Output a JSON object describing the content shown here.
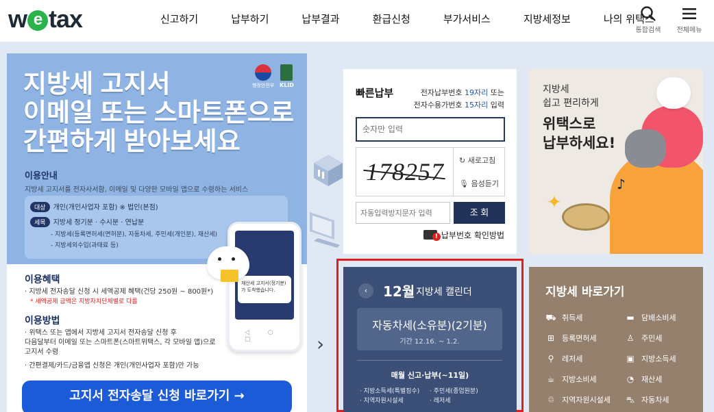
{
  "header": {
    "logo": {
      "prefix": "w",
      "e": "e",
      "suffix": "tax"
    },
    "nav": [
      "신고하기",
      "납부하기",
      "납부결과",
      "환급신청",
      "부가서비스",
      "지방세정보",
      "나의 위택스"
    ],
    "search_label": "통합검색",
    "menu_label": "전체메뉴"
  },
  "banner": {
    "title_lines": [
      "지방세 고지서",
      "이메일 또는 스마트폰으로",
      "간편하게 받아보세요"
    ],
    "gov_logo_text": "행정안전부",
    "klid_logo_text": "KLID",
    "guide_title": "이용안내",
    "guide_text": "지방세 고지서를 전자사서함, 이메일 및 다양한 모바일 앱으로 수령하는 서비스",
    "target_pill": "대상",
    "target_text": "개인(개인사업자 포함) ※ 법인(본점)",
    "tax_pill": "세목",
    "tax_text": "지방세 정기분 · 수시분 · 연납분",
    "tax_sub1": "- 지방세(등록면허세(면허분), 자동차세, 주민세(개인분), 재산세)",
    "tax_sub2": "- 지방세외수입(과태료 등)",
    "benefit_title": "이용혜택",
    "benefit_text": "· 지방세 전자송달 신청 시 세액공제 혜택(건당 250원 ~ 800원*)",
    "benefit_note": "* 세액공제 금액은 지방자치단체별로 다름",
    "method_title": "이용방법",
    "method_line1": "· 위택스 또는 앱에서 지방세 고지서 전자송달 신청 후",
    "method_line2": "  다음달부터 이메일 또는 스마트폰(스마트위택스, 각 모바일 앱)으로",
    "method_line3": "  고지서 수령",
    "method_line4": "· 간편결제/카드/금융앱 신청은 개인(개인사업자 포함)만 가능",
    "phone_note": "재산세 고지서(정기분)가 도착했습니다.",
    "phone_nav": "◁ ○ □",
    "cta": "고지서 전자송달 신청 바로가기 →"
  },
  "next_arrow": "›",
  "quick_pay": {
    "title": "빠른납부",
    "desc_line1_a": "전자납부번호 ",
    "desc_line1_hl": "19자리",
    "desc_line1_b": " 또는",
    "desc_line2_a": "전자수용가번호 ",
    "desc_line2_hl": "15자리",
    "desc_line2_b": " 입력",
    "number_placeholder": "숫자만 입력",
    "captcha_text": "178257",
    "refresh_label": "새로고침",
    "audio_label": "음성듣기",
    "captcha_placeholder": "자동입력방지문자 입력",
    "search_button": "조 회",
    "help_link": "납부번호 확인방법"
  },
  "calendar": {
    "prev": "‹",
    "month": "12월",
    "title": "지방세 캘린더",
    "item_name": "자동차세(소유분)(2기분)",
    "item_period": "기간 12.16. ~ 1.2.",
    "monthly": "매월 신고·납부(~11일)",
    "taxes": [
      "· 지방소득세(특별징수)",
      "· 주민세(종업원분)",
      "· 지역자원시설세",
      "· 레저세"
    ]
  },
  "promo": {
    "small_lines": [
      "지방세",
      "쉽고 편리하게"
    ],
    "big_lines": [
      "위택스로",
      "납부하세요!"
    ]
  },
  "shortcuts": {
    "title": "지방세 바로가기",
    "items": [
      {
        "icon": "car-icon",
        "glyph": "⛟",
        "label": "취득세"
      },
      {
        "icon": "tobacco-icon",
        "glyph": "▬",
        "label": "담배소비세"
      },
      {
        "icon": "license-icon",
        "glyph": "⊞",
        "label": "등록면허세"
      },
      {
        "icon": "person-icon",
        "glyph": "♙",
        "label": "주민세"
      },
      {
        "icon": "bicycle-icon",
        "glyph": "⚲",
        "label": "레저세"
      },
      {
        "icon": "income-icon",
        "glyph": "▣",
        "label": "지방소득세"
      },
      {
        "icon": "cup-icon",
        "glyph": "☕",
        "label": "지방소비세"
      },
      {
        "icon": "pie-icon",
        "glyph": "◔",
        "label": "재산세"
      },
      {
        "icon": "recycle-icon",
        "glyph": "♲",
        "label": "지역자원시설세"
      },
      {
        "icon": "auto-icon",
        "glyph": "⛍",
        "label": "자동차세"
      }
    ]
  }
}
